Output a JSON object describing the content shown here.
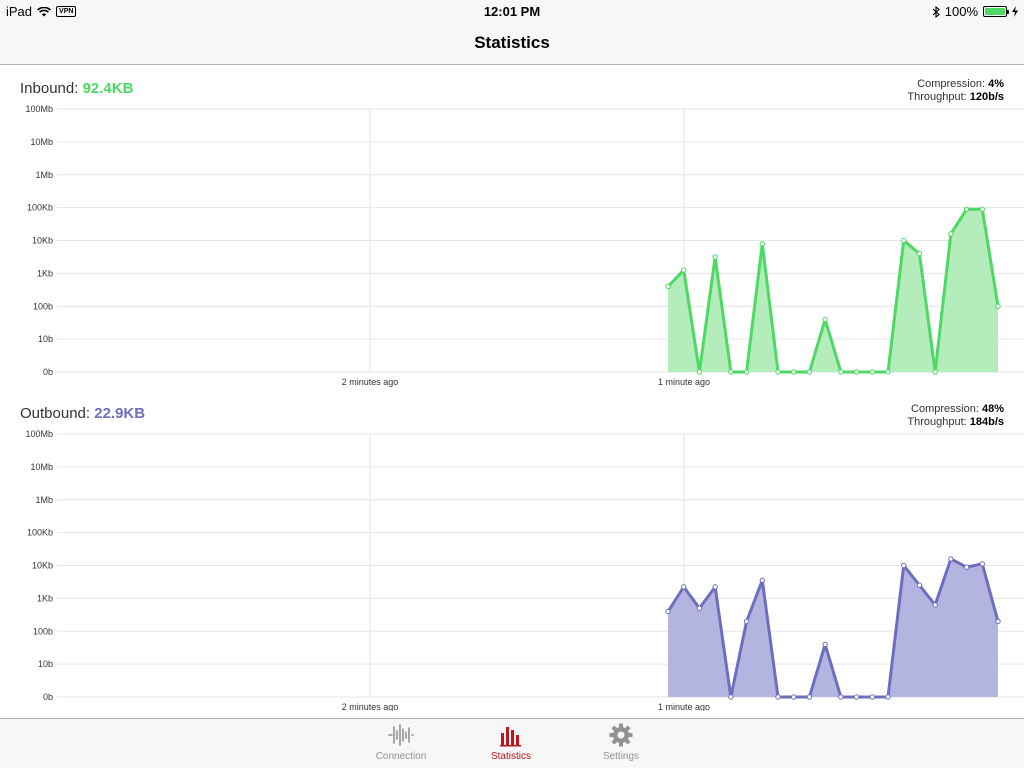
{
  "status_bar": {
    "device": "iPad",
    "vpn": "VPN",
    "time": "12:01 PM",
    "battery": "100%"
  },
  "nav": {
    "title": "Statistics"
  },
  "axis": {
    "y_ticks": [
      "0b",
      "10b",
      "100b",
      "1Kb",
      "10Kb",
      "100Kb",
      "1Mb",
      "10Mb",
      "100Mb"
    ],
    "x_ticks": [
      "2 minutes ago",
      "1 minute ago"
    ]
  },
  "inbound": {
    "label": "Inbound:",
    "total": "92.4KB",
    "color": "#4cd964",
    "fill": "#b4ecbc",
    "compression_label": "Compression:",
    "compression": "4%",
    "throughput_label": "Throughput:",
    "throughput": "120b/s"
  },
  "outbound": {
    "label": "Outbound:",
    "total": "22.9KB",
    "color": "#6e6ebe",
    "fill": "#b4b4e0",
    "compression_label": "Compression:",
    "compression": "48%",
    "throughput_label": "Throughput:",
    "throughput": "184b/s"
  },
  "chart_data": [
    {
      "type": "area",
      "title": "Inbound",
      "y_scale": "log10",
      "ylim": [
        0,
        8
      ],
      "x_range_seconds_ago": [
        -60,
        60
      ],
      "series": [
        {
          "name": "Inbound",
          "values": [
            2.6,
            3.1,
            0,
            3.5,
            0,
            0,
            3.9,
            0,
            0,
            0,
            1.6,
            0,
            0,
            0,
            0,
            4.0,
            3.6,
            0,
            4.2,
            4.95,
            4.95,
            2.0
          ]
        }
      ]
    },
    {
      "type": "area",
      "title": "Outbound",
      "y_scale": "log10",
      "ylim": [
        0,
        8
      ],
      "series": [
        {
          "name": "Outbound",
          "values": [
            2.6,
            3.35,
            2.7,
            3.35,
            0,
            2.3,
            3.55,
            0,
            0,
            0,
            1.6,
            0,
            0,
            0,
            0,
            4.0,
            3.4,
            2.8,
            4.2,
            3.95,
            4.05,
            2.3
          ]
        }
      ]
    }
  ],
  "tabs": [
    {
      "label": "Connection",
      "icon": "waveform-icon"
    },
    {
      "label": "Statistics",
      "icon": "bar-chart-icon"
    },
    {
      "label": "Settings",
      "icon": "gear-icon"
    }
  ]
}
